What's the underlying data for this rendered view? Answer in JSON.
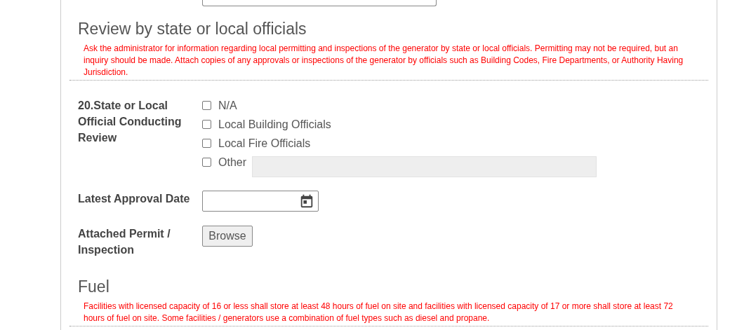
{
  "sections": [
    {
      "heading": "Review by state or local officials",
      "note": "Ask the administrator for information regarding local permitting and inspections of the generator by state or local officials. Permitting may not be required, but an inquiry should be made. Attach copies of any approvals or inspections of the generator by officials such as Building Codes, Fire Departments, or Authority Having Jurisdiction.",
      "fields": [
        {
          "kind": "checkboxes",
          "label": "20.State or Local Official Conducting Review",
          "options": [
            {
              "kind": "plain",
              "label": "N/A",
              "checked": false
            },
            {
              "kind": "plain",
              "label": "Local Building Officials",
              "checked": false
            },
            {
              "kind": "plain",
              "label": "Local Fire Officials",
              "checked": false
            },
            {
              "kind": "with_text_field",
              "label": "Other",
              "checked": false
            }
          ]
        },
        {
          "kind": "date",
          "label": "Latest Approval Date"
        },
        {
          "kind": "file",
          "label": "Attached Permit / Inspection",
          "button": "Browse"
        }
      ]
    },
    {
      "heading": "Fuel",
      "note": "Facilities with licensed capacity of 16 or less shall store at least 48 hours of fuel on site and facilities with licensed capacity of 17 or more shall store at least 72 hours of fuel on site. Some facilities / generators use a combination of fuel types such as diesel and propane."
    }
  ]
}
